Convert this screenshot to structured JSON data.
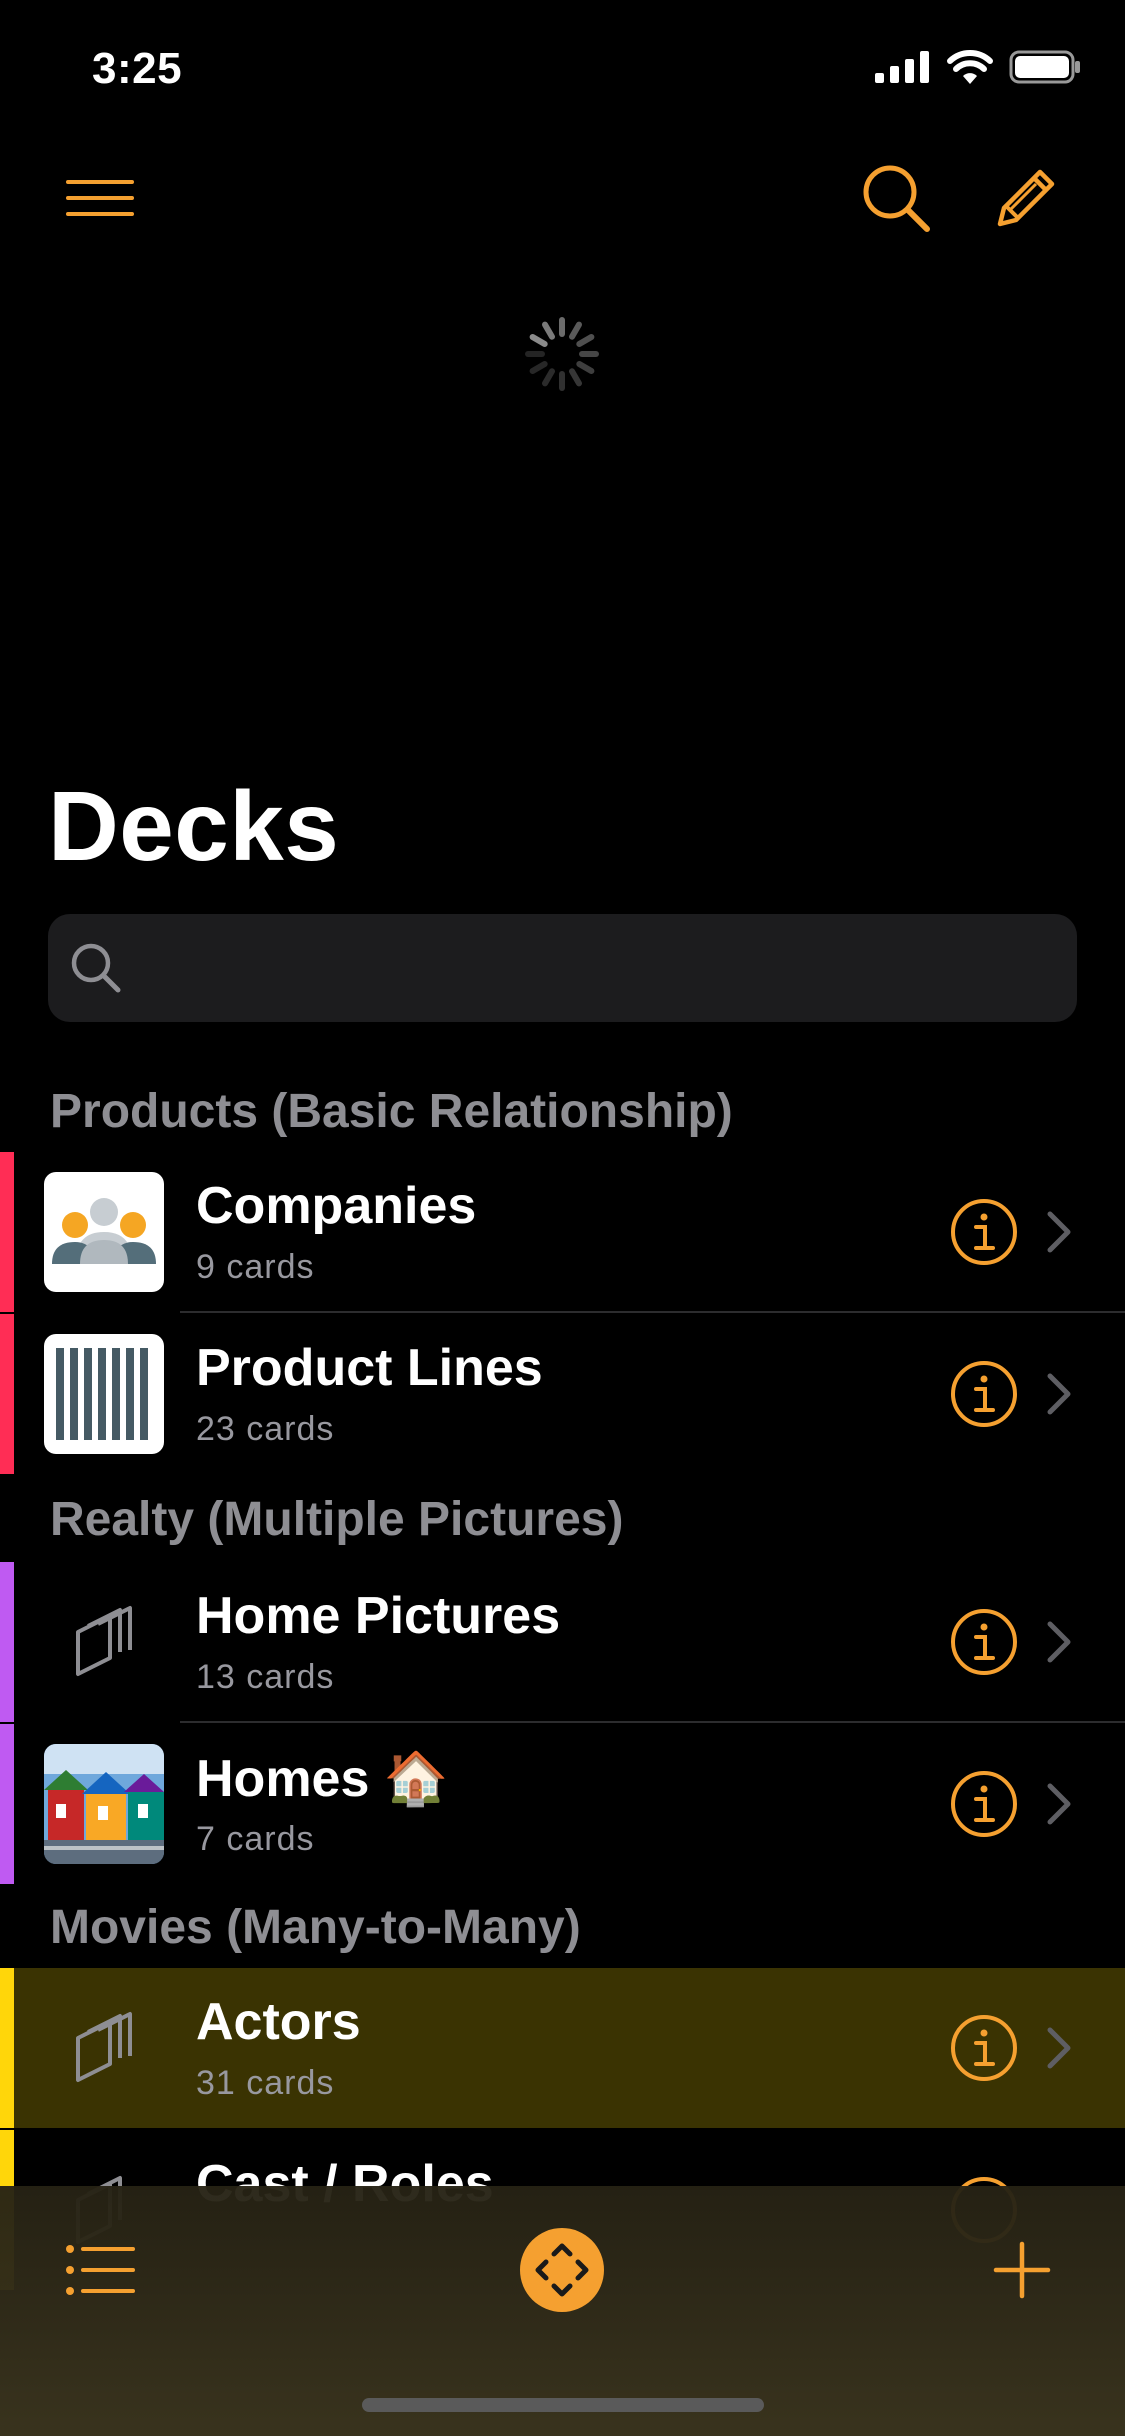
{
  "status_bar": {
    "time": "3:25"
  },
  "accent_color": "#f5a030",
  "icons": {
    "menu": "hamburger-icon",
    "search": "magnifying-glass-icon",
    "edit": "pencil-icon",
    "list": "list-icon",
    "center": "diamond-arrows-icon",
    "add": "plus-icon"
  },
  "page": {
    "title": "Decks"
  },
  "search": {
    "placeholder": ""
  },
  "sections": [
    {
      "header": "Products (Basic Relationship)",
      "color": "#ff2d55",
      "rows": [
        {
          "title": "Companies",
          "subtitle": "9 cards",
          "thumb": "people-icon"
        },
        {
          "title": "Product Lines",
          "subtitle": "23 cards",
          "thumb": "barcode-icon"
        }
      ]
    },
    {
      "header": "Realty (Multiple Pictures)",
      "color": "#bf5af2",
      "rows": [
        {
          "title": "Home Pictures",
          "subtitle": "13 cards",
          "thumb": "stacked-cards-icon"
        },
        {
          "title": "Homes 🏠",
          "subtitle": "7 cards",
          "thumb": "houses-photo"
        }
      ]
    },
    {
      "header": "Movies (Many-to-Many)",
      "color": "#ffd60a",
      "rows": [
        {
          "title": "Actors",
          "subtitle": "31 cards",
          "thumb": "stacked-cards-icon",
          "selected": true
        },
        {
          "title": "Cast / Roles",
          "subtitle": "",
          "thumb": "stacked-cards-icon"
        }
      ]
    }
  ]
}
